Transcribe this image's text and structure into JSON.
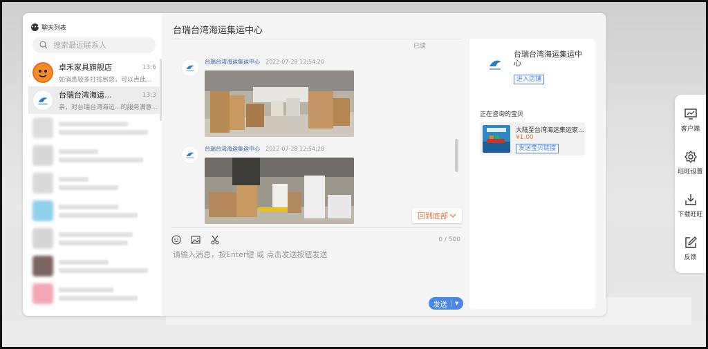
{
  "chat_list": {
    "title": "聊天列表",
    "search_placeholder": "搜索最近联系人",
    "contacts": [
      {
        "name": "卓禾家具旗舰店",
        "preview": "如消息较多打找到您，可以点此...",
        "time": "13:6"
      },
      {
        "name": "台瑞台湾海运...",
        "preview": "亲，对台瑞台湾海运...的服务满意...",
        "time": "13:3"
      }
    ]
  },
  "conversation": {
    "title": "台瑞台湾海运集运中心",
    "read_status": "已读",
    "messages": [
      {
        "sender": "台瑞台湾海运集运中心",
        "time": "2022-07-28 12:54:20"
      },
      {
        "sender": "台瑞台湾海运集运中心",
        "time": "2022-07-28 12:54:28"
      }
    ],
    "back_to_bottom": "回到底部",
    "input_counter": "0 / 500",
    "input_placeholder": "请输入消息，按Enter键 或 点击发送按钮发送",
    "send_label": "发送"
  },
  "shop_panel": {
    "shop_name": "台瑞台湾海运集运中心",
    "enter_shop": "进入店铺",
    "consulting_label": "正在咨询的宝贝",
    "product": {
      "title": "大陆至台湾海运集运家...",
      "price": "¥1.00",
      "send_link": "发送宝贝链接"
    }
  },
  "toolbar": {
    "items": [
      {
        "label": "客户端",
        "icon": "monitor-icon"
      },
      {
        "label": "旺旺设置",
        "icon": "gear-icon"
      },
      {
        "label": "下载旺旺",
        "icon": "download-icon"
      },
      {
        "label": "反馈",
        "icon": "edit-icon"
      }
    ]
  },
  "colors": {
    "accent": "#4b87e8",
    "link": "#3a62a8",
    "orange": "#e9793a"
  }
}
